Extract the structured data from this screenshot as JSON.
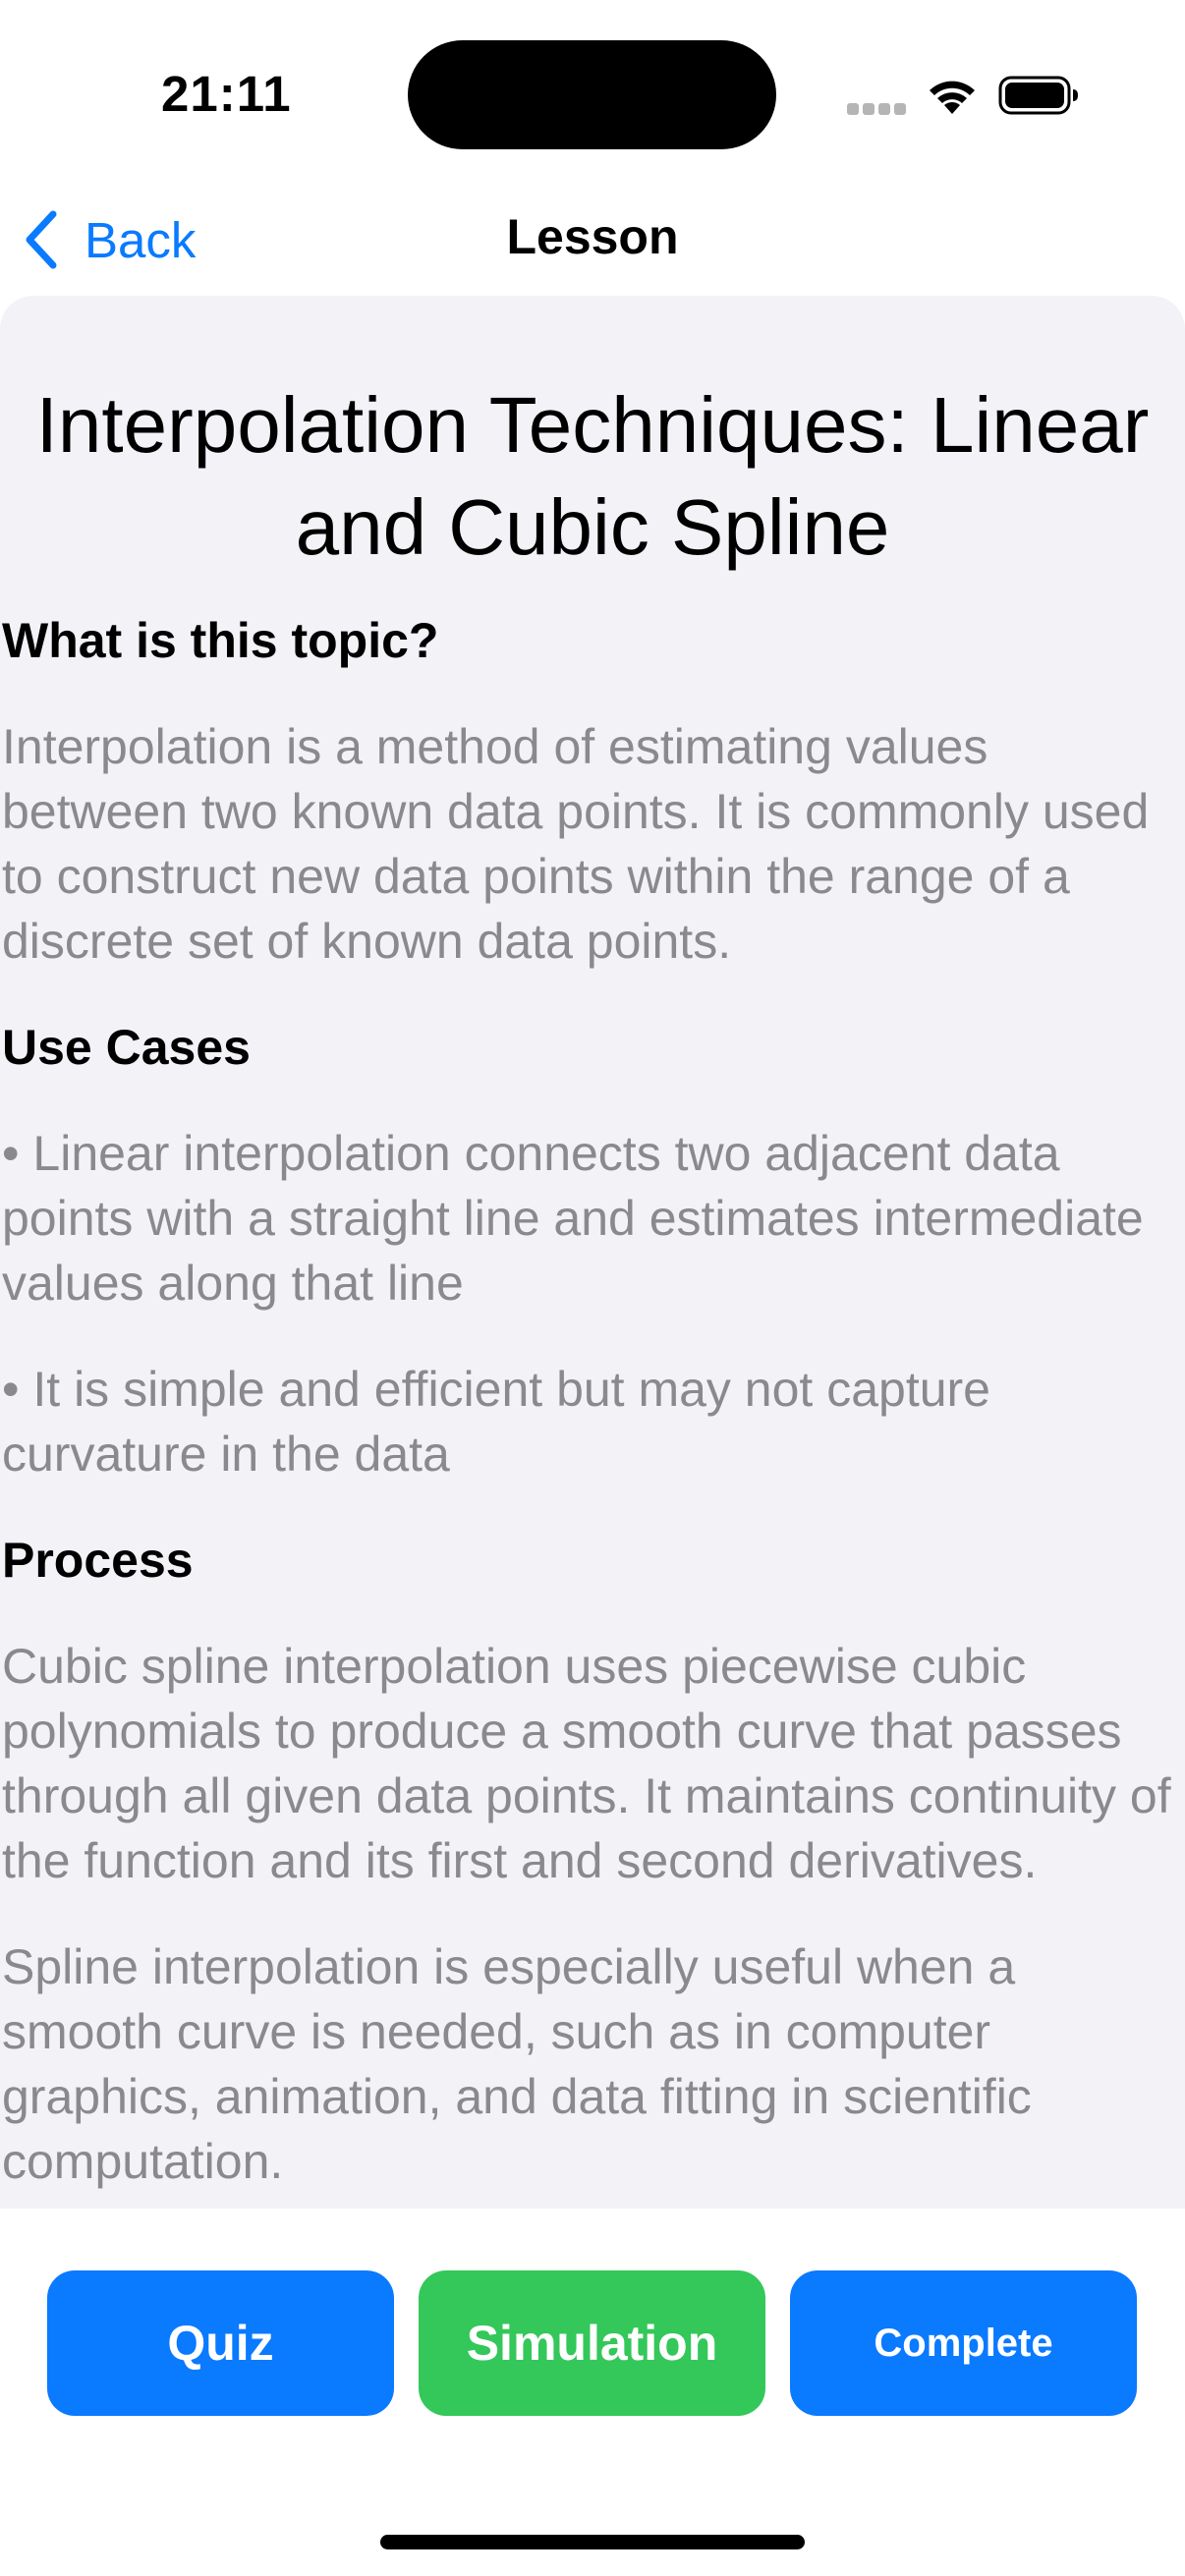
{
  "status_bar": {
    "time": "21:11",
    "icons": [
      "cellular-signal-icon",
      "wifi-icon",
      "battery-icon"
    ]
  },
  "nav": {
    "back_label": "Back",
    "title": "Lesson"
  },
  "lesson": {
    "title": "Interpolation Techniques: Linear and Cubic Spline",
    "sections": {
      "what_heading": "What is this topic?",
      "what_body": "Interpolation is a method of estimating values between two known data points. It is commonly used to construct new data points within the range of a discrete set of known data points.",
      "use_cases_heading": "Use Cases",
      "use_case_1": "• Linear interpolation connects two adjacent data points with a straight line and estimates intermediate values along that line",
      "use_case_2": "• It is simple and efficient but may not capture curvature in the data",
      "process_heading": "Process",
      "process_body_1": "Cubic spline interpolation uses piecewise cubic polynomials to produce a smooth curve that passes through all given data points. It maintains continuity of the function and its first and second derivatives.",
      "process_body_2": "Spline interpolation is especially useful when a smooth curve is needed, such as in computer graphics, animation, and data fitting in scientific computation."
    }
  },
  "actions": {
    "quiz_label": "Quiz",
    "simulation_label": "Simulation",
    "complete_label": "Complete"
  },
  "colors": {
    "accent_blue": "#0a7aff",
    "accent_green": "#34c759",
    "card_background": "#f2f2f7",
    "body_text": "#8a8a8e"
  }
}
